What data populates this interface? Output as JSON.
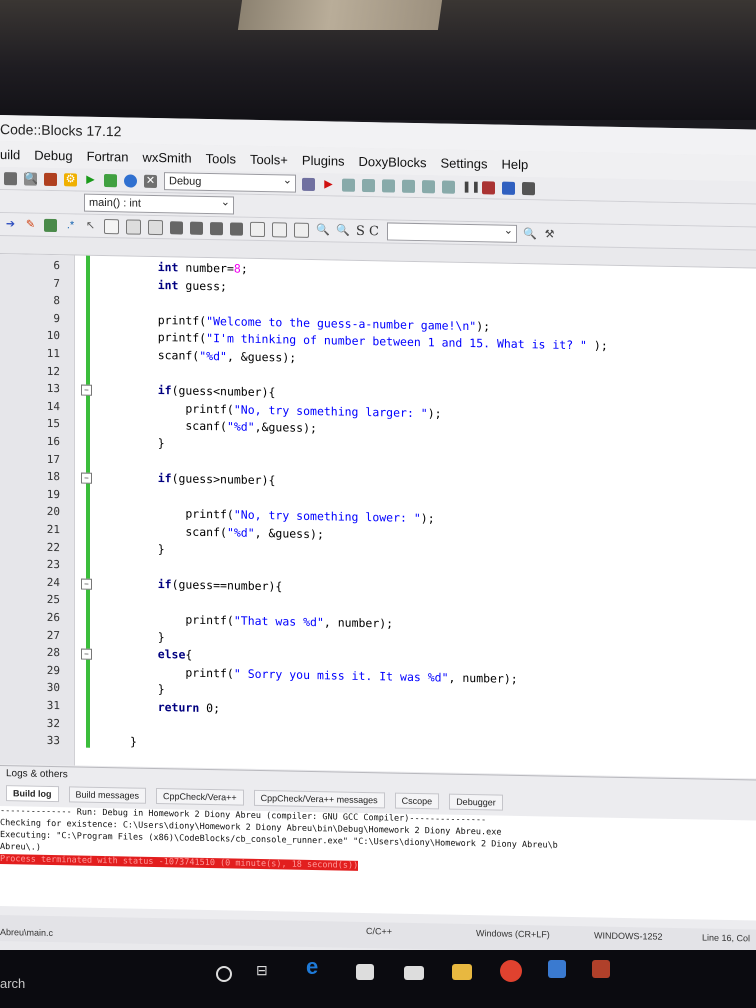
{
  "window": {
    "title": "Code::Blocks 17.12"
  },
  "menu": [
    "uild",
    "Debug",
    "Fortran",
    "wxSmith",
    "Tools",
    "Tools+",
    "Plugins",
    "DoxyBlocks",
    "Settings",
    "Help"
  ],
  "toolbar": {
    "build_target": "Debug",
    "function_scope": "main() : int",
    "search_letters": "S C"
  },
  "code_lines": [
    {
      "n": "6",
      "t": "    int number=8;"
    },
    {
      "n": "7",
      "t": "    int guess;"
    },
    {
      "n": "8",
      "t": ""
    },
    {
      "n": "9",
      "t": "    printf(\"Welcome to the guess-a-number game!\\n\");"
    },
    {
      "n": "10",
      "t": "    printf(\"I'm thinking of number between 1 and 15. What is it? \" );"
    },
    {
      "n": "11",
      "t": "    scanf(\"%d\", &guess);"
    },
    {
      "n": "12",
      "t": ""
    },
    {
      "n": "13",
      "t": "    if(guess<number){"
    },
    {
      "n": "14",
      "t": "        printf(\"No, try something larger: \");"
    },
    {
      "n": "15",
      "t": "        scanf(\"%d\",&guess);"
    },
    {
      "n": "16",
      "t": "    }"
    },
    {
      "n": "17",
      "t": ""
    },
    {
      "n": "18",
      "t": "    if(guess>number){"
    },
    {
      "n": "19",
      "t": ""
    },
    {
      "n": "20",
      "t": "        printf(\"No, try something lower: \");"
    },
    {
      "n": "21",
      "t": "        scanf(\"%d\", &guess);"
    },
    {
      "n": "22",
      "t": "    }"
    },
    {
      "n": "23",
      "t": ""
    },
    {
      "n": "24",
      "t": "    if(guess==number){"
    },
    {
      "n": "25",
      "t": ""
    },
    {
      "n": "26",
      "t": "        printf(\"That was %d\", number);"
    },
    {
      "n": "27",
      "t": "    }"
    },
    {
      "n": "28",
      "t": "    else{"
    },
    {
      "n": "29",
      "t": "        printf(\" Sorry you miss it. It was %d\", number);"
    },
    {
      "n": "30",
      "t": "    }"
    },
    {
      "n": "31",
      "t": "    return 0;"
    },
    {
      "n": "32",
      "t": ""
    },
    {
      "n": "33",
      "t": "}"
    }
  ],
  "logs": {
    "title": "Logs & others",
    "tabs": [
      "Build log",
      "Build messages",
      "CppCheck/Vera++",
      "CppCheck/Vera++ messages",
      "Cscope",
      "Debugger"
    ],
    "lines": [
      "-------------- Run: Debug in Homework 2 Diony Abreu (compiler: GNU GCC Compiler)---------------",
      "Checking for existence: C:\\Users\\diony\\Homework 2 Diony Abreu\\bin\\Debug\\Homework 2 Diony Abreu.exe",
      "Executing: \"C:\\Program Files (x86)\\CodeBlocks/cb_console_runner.exe\" \"C:\\Users\\diony\\Homework 2 Diony Abreu\\b",
      "Abreu\\.)"
    ],
    "error": "Process terminated with status -1073741510 (0 minute(s), 18 second(s))"
  },
  "status": {
    "file": "Abreu\\main.c",
    "language": "C/C++",
    "eol": "Windows (CR+LF)",
    "encoding": "WINDOWS-1252",
    "position": "Line 16, Col"
  },
  "taskbar": {
    "search": "arch"
  }
}
